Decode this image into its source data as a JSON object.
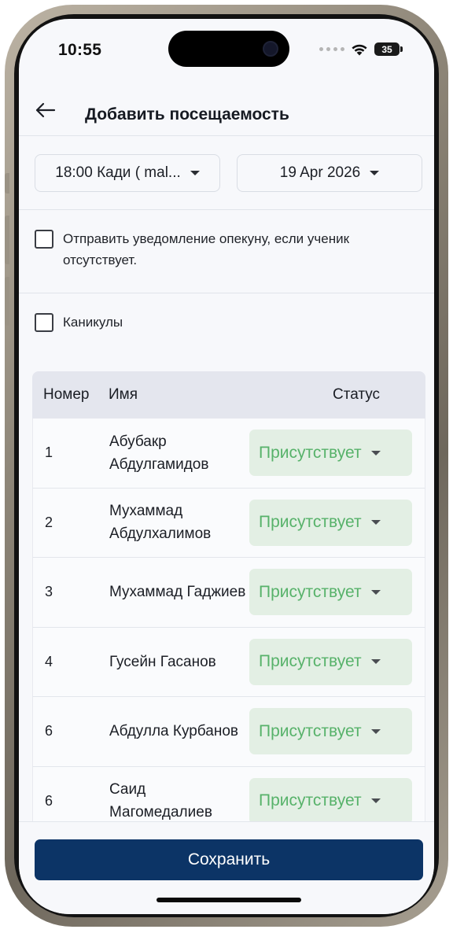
{
  "status_bar": {
    "time": "10:55",
    "battery": "35"
  },
  "header": {
    "title": "Добавить посещаемость"
  },
  "filters": {
    "group_dropdown": "18:00 Кади ( mal...",
    "date_dropdown": "19 Apr 2026"
  },
  "options": {
    "notify_guardian_label": "Отправить уведомление опекуну, если ученик отсутствует.",
    "notify_guardian_checked": false,
    "holidays_label": "Каникулы",
    "holidays_checked": false
  },
  "table": {
    "headers": {
      "number": "Номер",
      "name": "Имя",
      "status": "Статус"
    },
    "rows": [
      {
        "number": "1",
        "name": "Абубакр Абдулгамидов",
        "status": "Присутствует"
      },
      {
        "number": "2",
        "name": "Мухаммад Абдулхалимов",
        "status": "Присутствует"
      },
      {
        "number": "3",
        "name": "Мухаммад Гаджиев",
        "status": "Присутствует"
      },
      {
        "number": "4",
        "name": "Гусейн Гасанов",
        "status": "Присутствует"
      },
      {
        "number": "6",
        "name": "Абдулла Курбанов",
        "status": "Присутствует"
      },
      {
        "number": "6",
        "name": "Саид Магомедалиев",
        "status": "Присутствует"
      }
    ]
  },
  "footer": {
    "save_label": "Сохранить"
  },
  "colors": {
    "primary": "#0c3466",
    "present_text": "#57b26a",
    "present_bg": "#e3efe4",
    "table_header_bg": "#e4e6ee"
  },
  "icons": {
    "back": "arrow-left-icon",
    "dropdown": "caret-down-icon",
    "wifi": "wifi-icon",
    "battery": "battery-icon"
  }
}
